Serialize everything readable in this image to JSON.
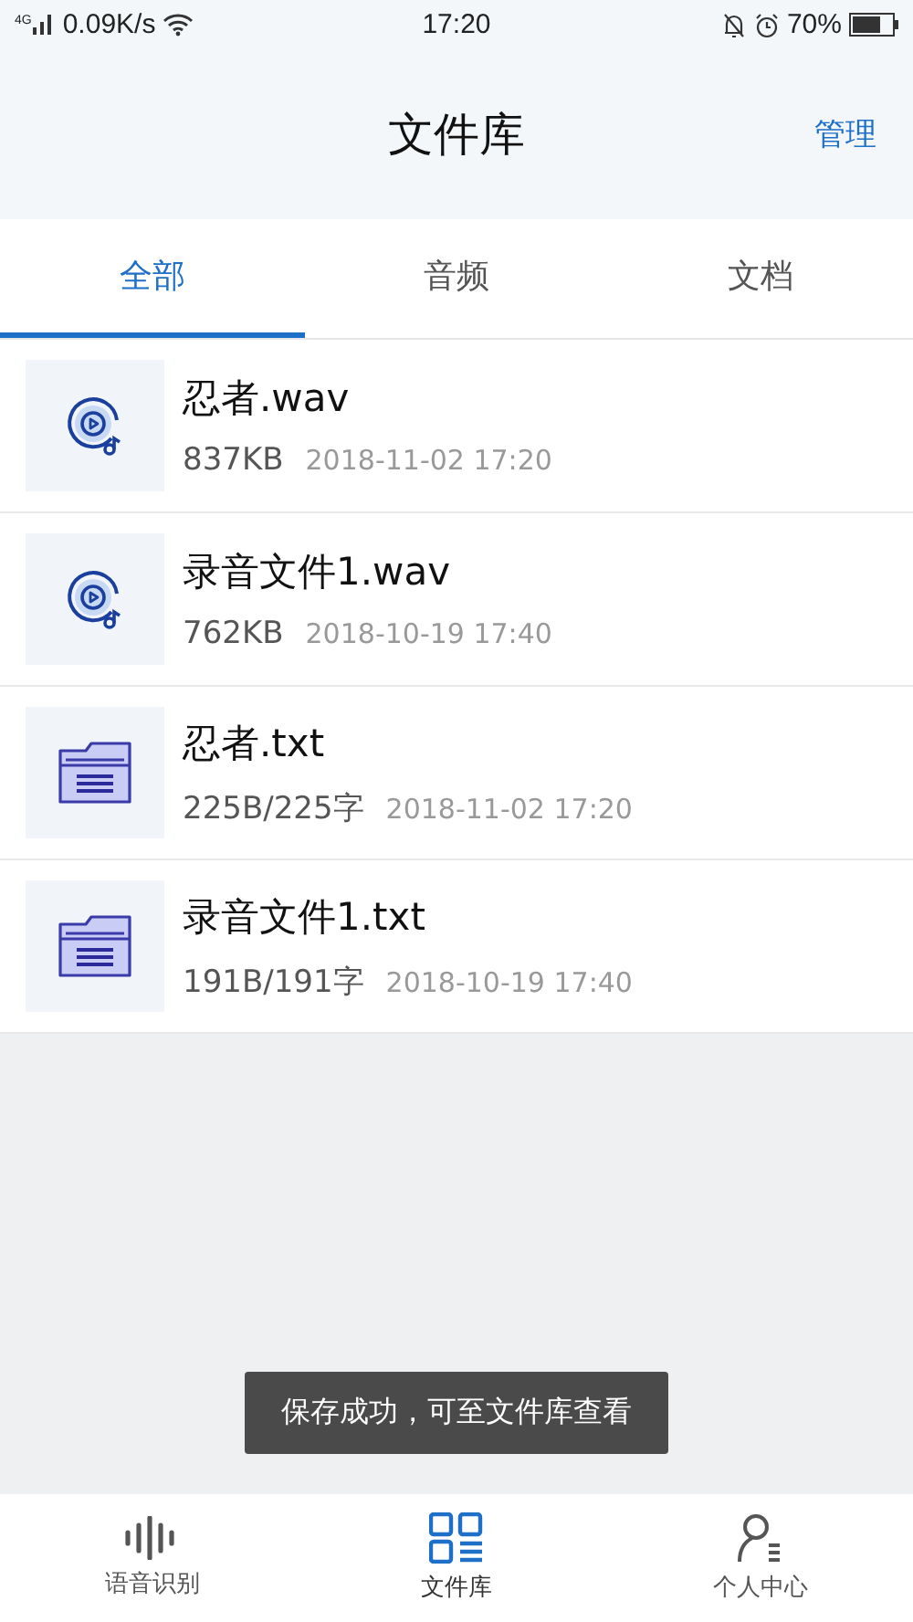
{
  "status_bar": {
    "network": "4G",
    "speed": "0.09K/s",
    "time": "17:20",
    "battery": "70%"
  },
  "header": {
    "title": "文件库",
    "action": "管理"
  },
  "tabs": [
    {
      "label": "全部",
      "selected": true
    },
    {
      "label": "音频",
      "selected": false
    },
    {
      "label": "文档",
      "selected": false
    }
  ],
  "files": [
    {
      "kind": "audio",
      "name": "忍者.wav",
      "size": "837KB",
      "date": "2018-11-02 17:20"
    },
    {
      "kind": "audio",
      "name": "录音文件1.wav",
      "size": "762KB",
      "date": "2018-10-19 17:40"
    },
    {
      "kind": "text",
      "name": "忍者.txt",
      "size": "225B/225字",
      "date": "2018-11-02 17:20"
    },
    {
      "kind": "text",
      "name": "录音文件1.txt",
      "size": "191B/191字",
      "date": "2018-10-19 17:40"
    }
  ],
  "toast": "保存成功，可至文件库查看",
  "bottom_nav": [
    {
      "kind": "voice",
      "label": "语音识别",
      "selected": false
    },
    {
      "kind": "files",
      "label": "文件库",
      "selected": true
    },
    {
      "kind": "profile",
      "label": "个人中心",
      "selected": false
    }
  ]
}
